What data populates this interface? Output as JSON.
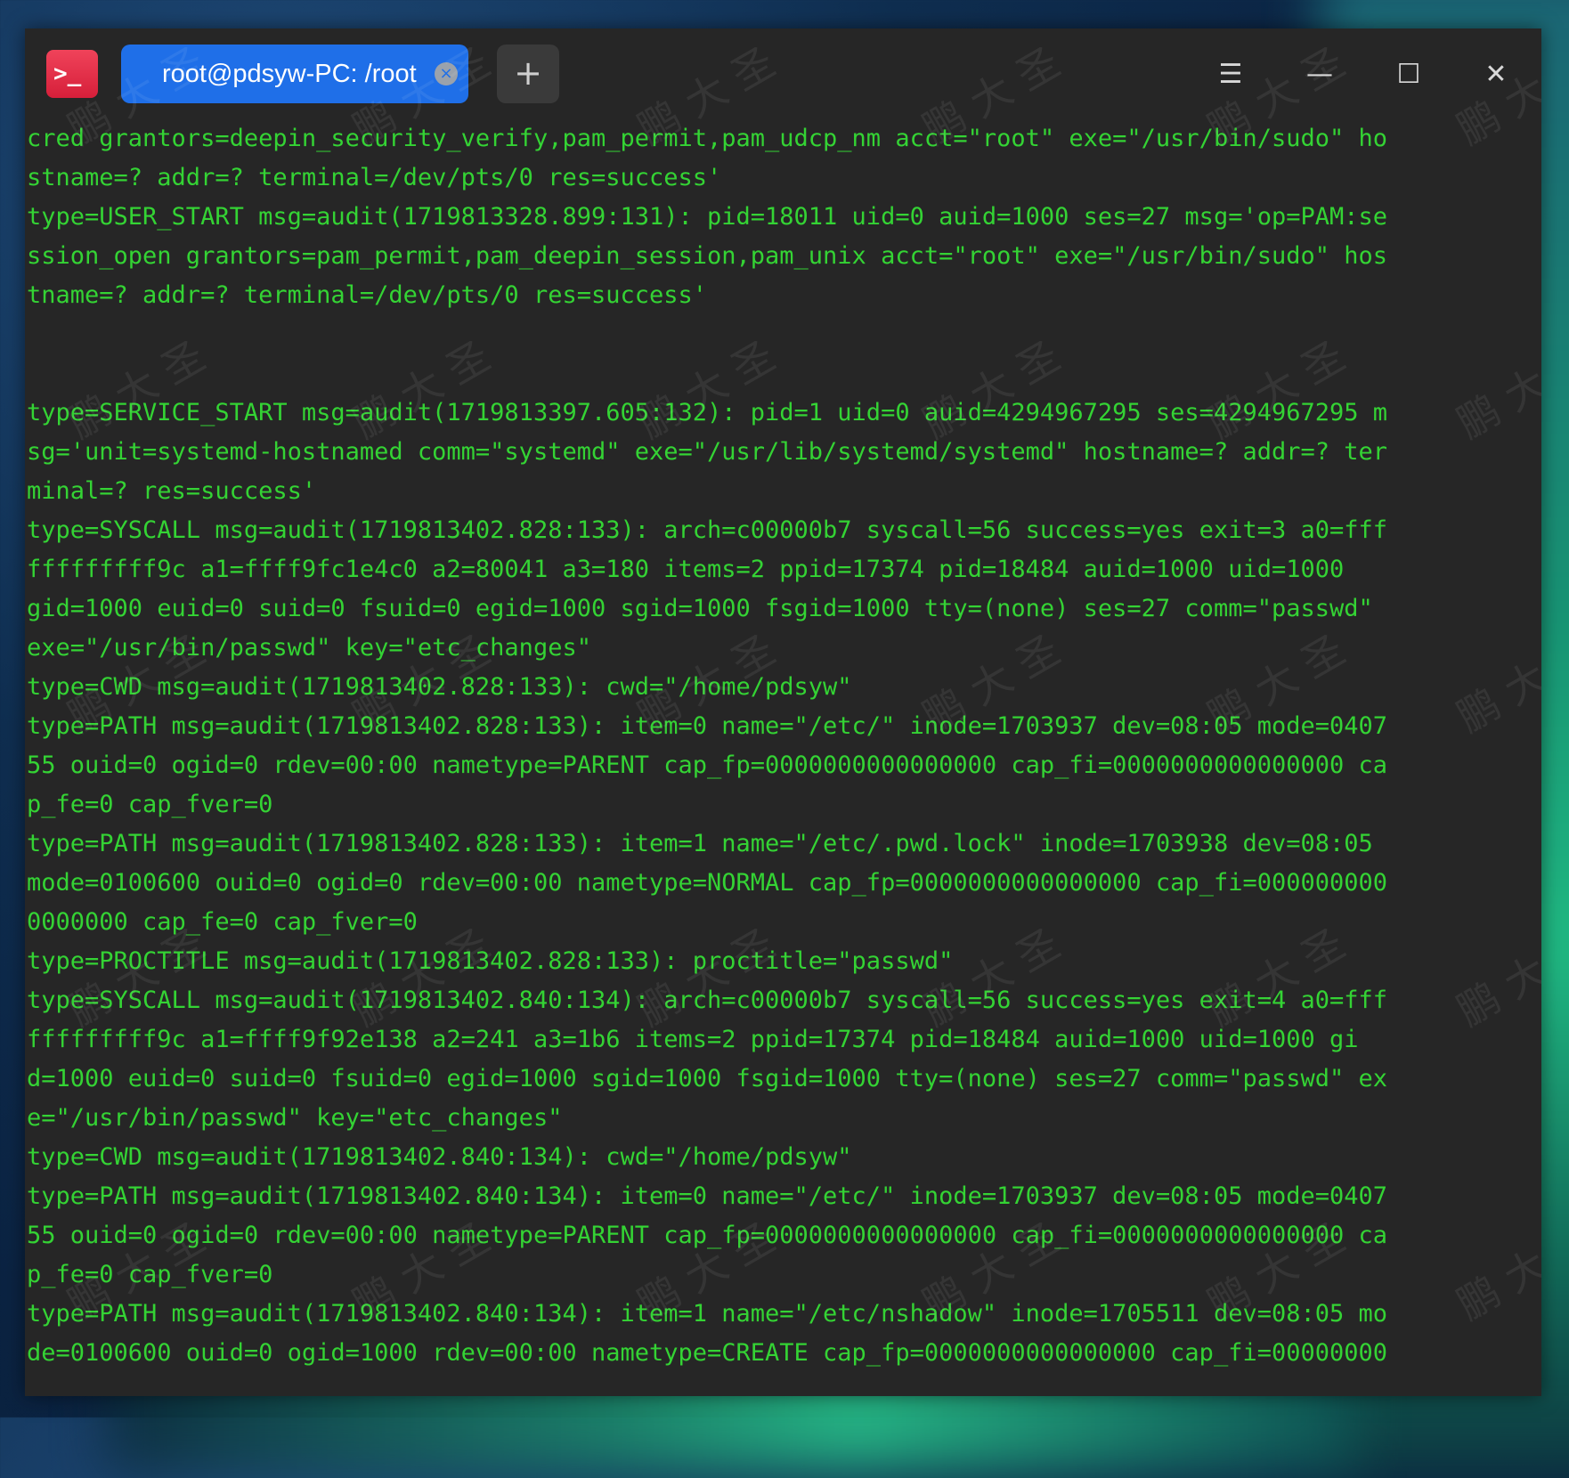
{
  "titlebar": {
    "tab_label": "root@pdsyw-PC: /root",
    "tab_close_glyph": "×",
    "new_tab_glyph": "+",
    "menu_glyph": "☰",
    "minimize_glyph": "—",
    "maximize_glyph": "☐",
    "close_glyph": "✕",
    "app_icon_glyph": ">_"
  },
  "colors": {
    "terminal_bg": "#262626",
    "text_green": "#34d334",
    "tab_blue": "#1f6fe8",
    "app_icon_red": "#e23048"
  },
  "icons": {
    "app": "terminal-icon",
    "menu": "hamburger-menu-icon",
    "minimize": "minimize-icon",
    "maximize": "maximize-icon",
    "close": "close-icon"
  },
  "watermark_text": "鹏 大 圣",
  "terminal": {
    "lines": [
      "cred grantors=deepin_security_verify,pam_permit,pam_udcp_nm acct=\"root\" exe=\"/usr/bin/sudo\" ho",
      "stname=? addr=? terminal=/dev/pts/0 res=success'",
      "type=USER_START msg=audit(1719813328.899:131): pid=18011 uid=0 auid=1000 ses=27 msg='op=PAM:se",
      "ssion_open grantors=pam_permit,pam_deepin_session,pam_unix acct=\"root\" exe=\"/usr/bin/sudo\" hos",
      "tname=? addr=? terminal=/dev/pts/0 res=success'",
      "",
      "",
      "type=SERVICE_START msg=audit(1719813397.605:132): pid=1 uid=0 auid=4294967295 ses=4294967295 m",
      "sg='unit=systemd-hostnamed comm=\"systemd\" exe=\"/usr/lib/systemd/systemd\" hostname=? addr=? ter",
      "minal=? res=success'",
      "type=SYSCALL msg=audit(1719813402.828:133): arch=c00000b7 syscall=56 success=yes exit=3 a0=fff",
      "fffffffff9c a1=ffff9fc1e4c0 a2=80041 a3=180 items=2 ppid=17374 pid=18484 auid=1000 uid=1000",
      "gid=1000 euid=0 suid=0 fsuid=0 egid=1000 sgid=1000 fsgid=1000 tty=(none) ses=27 comm=\"passwd\"",
      "exe=\"/usr/bin/passwd\" key=\"etc_changes\"",
      "type=CWD msg=audit(1719813402.828:133): cwd=\"/home/pdsyw\"",
      "type=PATH msg=audit(1719813402.828:133): item=0 name=\"/etc/\" inode=1703937 dev=08:05 mode=0407",
      "55 ouid=0 ogid=0 rdev=00:00 nametype=PARENT cap_fp=0000000000000000 cap_fi=0000000000000000 ca",
      "p_fe=0 cap_fver=0",
      "type=PATH msg=audit(1719813402.828:133): item=1 name=\"/etc/.pwd.lock\" inode=1703938 dev=08:05",
      "mode=0100600 ouid=0 ogid=0 rdev=00:00 nametype=NORMAL cap_fp=0000000000000000 cap_fi=000000000",
      "0000000 cap_fe=0 cap_fver=0",
      "type=PROCTITLE msg=audit(1719813402.828:133): proctitle=\"passwd\"",
      "type=SYSCALL msg=audit(1719813402.840:134): arch=c00000b7 syscall=56 success=yes exit=4 a0=fff",
      "fffffffff9c a1=ffff9f92e138 a2=241 a3=1b6 items=2 ppid=17374 pid=18484 auid=1000 uid=1000 gi",
      "d=1000 euid=0 suid=0 fsuid=0 egid=1000 sgid=1000 fsgid=1000 tty=(none) ses=27 comm=\"passwd\" ex",
      "e=\"/usr/bin/passwd\" key=\"etc_changes\"",
      "type=CWD msg=audit(1719813402.840:134): cwd=\"/home/pdsyw\"",
      "type=PATH msg=audit(1719813402.840:134): item=0 name=\"/etc/\" inode=1703937 dev=08:05 mode=0407",
      "55 ouid=0 ogid=0 rdev=00:00 nametype=PARENT cap_fp=0000000000000000 cap_fi=0000000000000000 ca",
      "p_fe=0 cap_fver=0",
      "type=PATH msg=audit(1719813402.840:134): item=1 name=\"/etc/nshadow\" inode=1705511 dev=08:05 mo",
      "de=0100600 ouid=0 ogid=1000 rdev=00:00 nametype=CREATE cap_fp=0000000000000000 cap_fi=00000000"
    ]
  }
}
